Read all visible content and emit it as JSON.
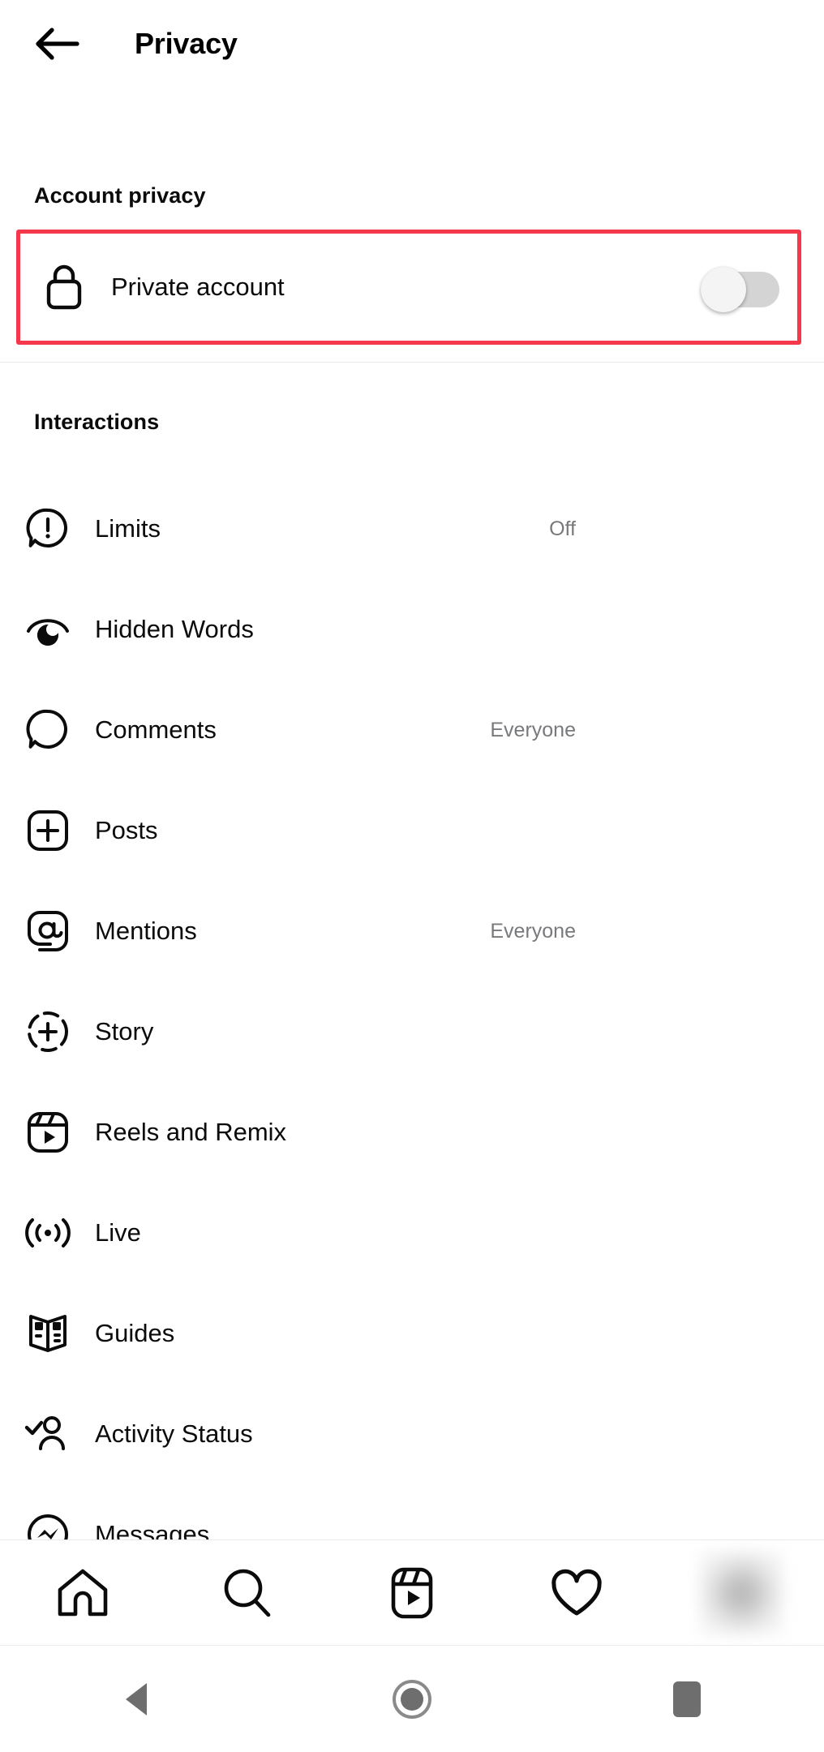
{
  "header": {
    "back_icon": "arrow-left-icon",
    "title": "Privacy"
  },
  "sections": {
    "account_privacy": {
      "label": "Account privacy",
      "highlight_color": "#f5374b",
      "row": {
        "icon": "lock-icon",
        "label": "Private account",
        "toggle_state": "off"
      }
    },
    "interactions": {
      "label": "Interactions",
      "rows": [
        {
          "icon": "limits-icon",
          "label": "Limits",
          "value": "Off"
        },
        {
          "icon": "hidden-words-icon",
          "label": "Hidden Words",
          "value": ""
        },
        {
          "icon": "comment-bubble-icon",
          "label": "Comments",
          "value": "Everyone"
        },
        {
          "icon": "posts-plus-icon",
          "label": "Posts",
          "value": ""
        },
        {
          "icon": "mentions-at-icon",
          "label": "Mentions",
          "value": "Everyone"
        },
        {
          "icon": "story-plus-icon",
          "label": "Story",
          "value": ""
        },
        {
          "icon": "reels-icon",
          "label": "Reels and Remix",
          "value": ""
        },
        {
          "icon": "live-broadcast-icon",
          "label": "Live",
          "value": ""
        },
        {
          "icon": "guides-book-icon",
          "label": "Guides",
          "value": ""
        },
        {
          "icon": "activity-status-icon",
          "label": "Activity Status",
          "value": ""
        },
        {
          "icon": "messenger-icon",
          "label": "Messages",
          "value": ""
        }
      ]
    }
  },
  "tabbar": {
    "items": [
      {
        "icon": "home-icon",
        "name": "tab-home"
      },
      {
        "icon": "search-icon",
        "name": "tab-search"
      },
      {
        "icon": "reels-icon",
        "name": "tab-reels"
      },
      {
        "icon": "heart-icon",
        "name": "tab-activity"
      },
      {
        "icon": "avatar-icon",
        "name": "tab-profile"
      }
    ]
  },
  "navbar": {
    "items": [
      {
        "icon": "android-back-icon"
      },
      {
        "icon": "android-home-icon"
      },
      {
        "icon": "android-recents-icon"
      }
    ]
  },
  "colors": {
    "text_primary": "#0b0b0b",
    "text_secondary": "#77797c",
    "highlight": "#f5374b",
    "divider": "#e9e9e9",
    "toggle_track_off": "#d4d4d4"
  }
}
